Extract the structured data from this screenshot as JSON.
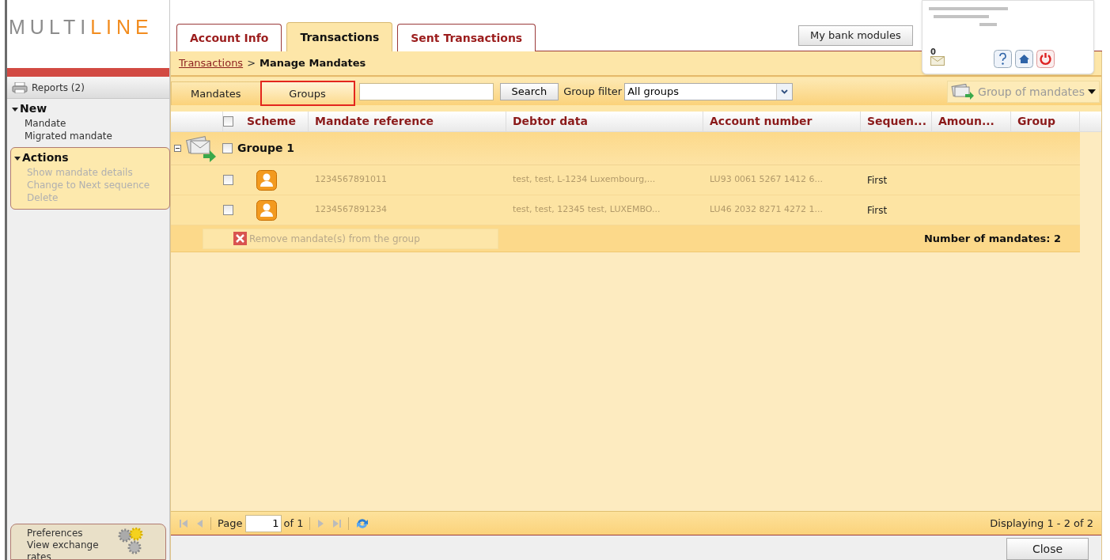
{
  "logo": {
    "first": "MULTI",
    "second": "LINE"
  },
  "tabs": [
    {
      "label": "Account Info",
      "selected": false
    },
    {
      "label": "Transactions",
      "selected": true
    },
    {
      "label": "Sent Transactions",
      "selected": false
    }
  ],
  "bank_modules_button": "My bank modules",
  "messages_count": "0",
  "breadcrumb": {
    "link": "Transactions",
    "separator": ">",
    "current": "Manage Mandates"
  },
  "sidebar": {
    "reports": "Reports (2)",
    "sections": [
      {
        "title": "New",
        "expanded": true,
        "items": [
          {
            "label": "Mandate",
            "disabled": false
          },
          {
            "label": "Migrated mandate",
            "disabled": false
          }
        ]
      },
      {
        "title": "Actions",
        "expanded": true,
        "items": [
          {
            "label": "Show mandate details",
            "disabled": true
          },
          {
            "label": "Change to Next sequence",
            "disabled": true
          },
          {
            "label": "Delete",
            "disabled": true
          }
        ]
      }
    ],
    "bottom_links": [
      "Preferences",
      "View exchange rates"
    ]
  },
  "subtabs": [
    {
      "label": "Mandates",
      "selected": false,
      "highlighted": false
    },
    {
      "label": "Groups",
      "selected": true,
      "highlighted": true
    }
  ],
  "search_button": "Search",
  "group_filter": {
    "label": "Group filter",
    "value": "All groups"
  },
  "group_menu": {
    "label": "Group of mandates",
    "disabled": true
  },
  "table": {
    "all_checked": false,
    "columns": [
      "Scheme",
      "Mandate reference",
      "Debtor data",
      "Account number",
      "Sequen...",
      "Amoun...",
      "Group"
    ],
    "group": {
      "name": "Groupe 1",
      "expanded": true,
      "checked": false,
      "rows": [
        {
          "checked": false,
          "mandate_reference": "1234567891011",
          "debtor_data": "test, test, L-1234 Luxembourg,...",
          "account_number": "LU93 0061 5267 1412 6...",
          "sequence": "First"
        },
        {
          "checked": false,
          "mandate_reference": "1234567891234",
          "debtor_data": "test, test, 12345 test, LUXEMBO...",
          "account_number": "LU46 2032 8271 4272 1...",
          "sequence": "First"
        }
      ],
      "remove_button": {
        "label": "Remove mandate(s) from the group",
        "disabled": true
      },
      "summary": "Number of mandates: 2"
    }
  },
  "paging": {
    "label": "Page",
    "page": "1",
    "of": "of 1",
    "display": "Displaying 1 - 2 of 2"
  },
  "close_button": "Close"
}
